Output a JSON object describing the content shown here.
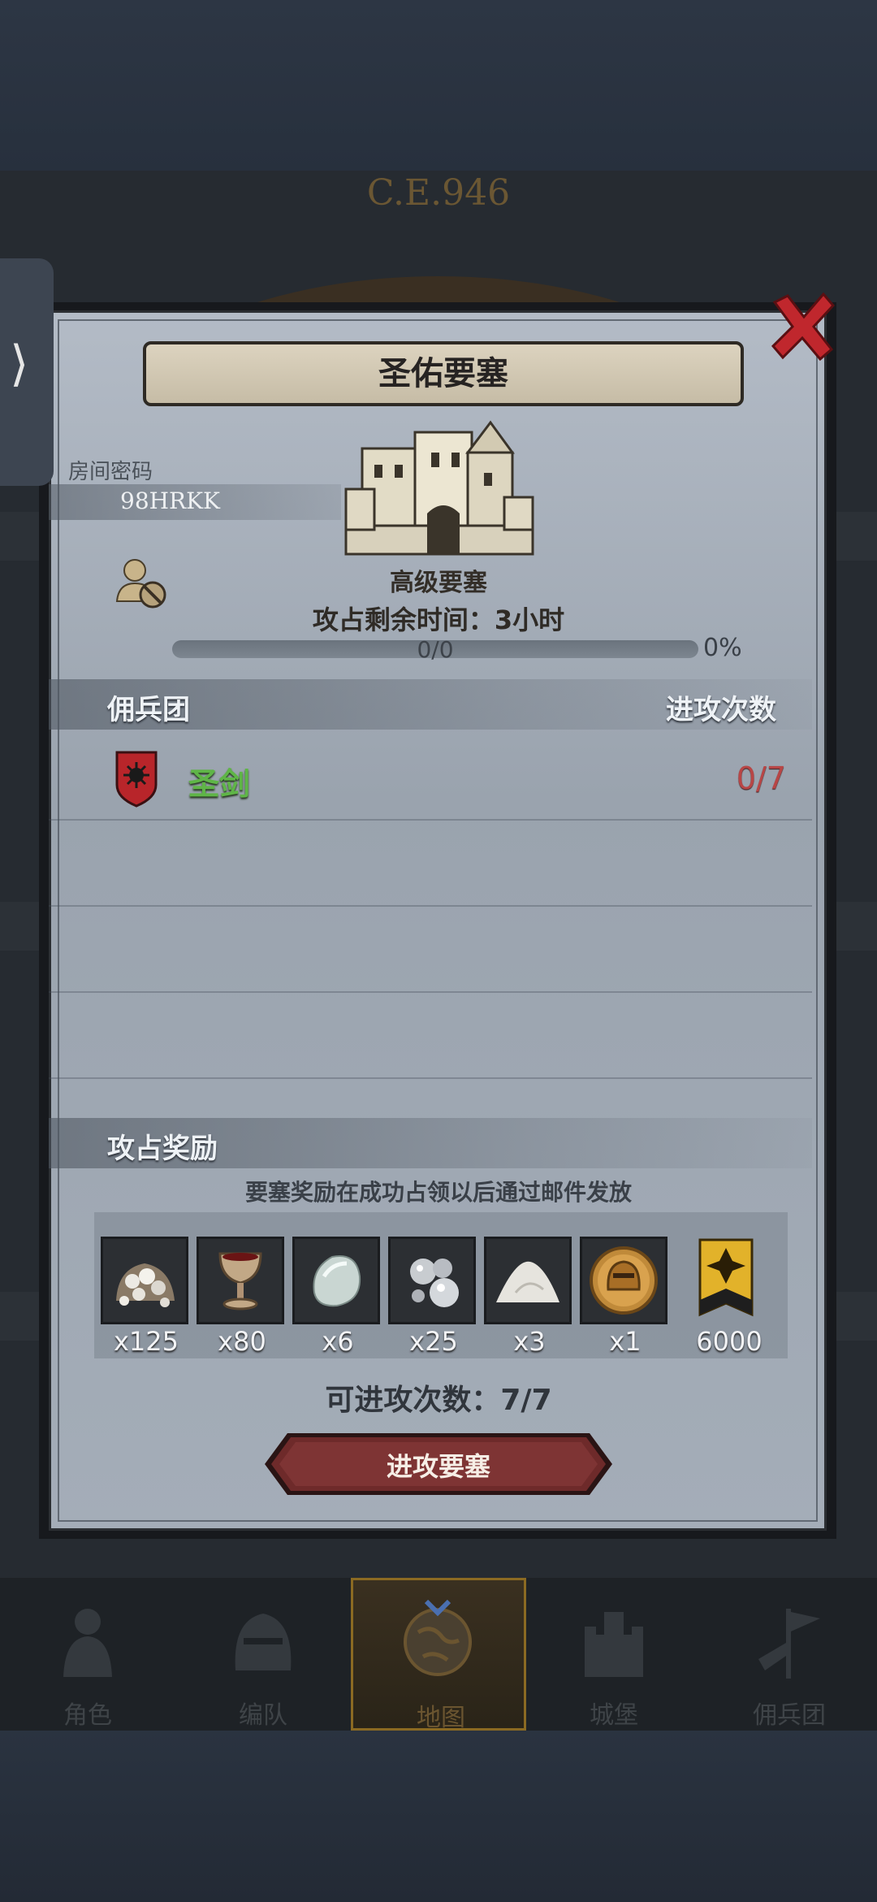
{
  "header": {
    "year": "C.E.946"
  },
  "modal": {
    "title": "圣佑要塞",
    "room_label": "房间密码",
    "room_code": "98HRKK",
    "fortress_type": "高级要塞",
    "time_label": "攻占剩余时间：",
    "time_value": "3小时",
    "progress_text": "0/0",
    "progress_pct": "0%",
    "progress_fraction": 0,
    "mercenary_header": "佣兵团",
    "attack_count_header": "进攻次数",
    "mercenaries": [
      {
        "name": "圣剑",
        "count": "0/7"
      }
    ],
    "reward_header": "攻占奖励",
    "reward_note": "要塞奖励在成功占领以后通过邮件发放",
    "rewards": [
      {
        "icon": "silver-ore-icon",
        "qty": "x125"
      },
      {
        "icon": "goblet-icon",
        "qty": "x80"
      },
      {
        "icon": "gem-stone-icon",
        "qty": "x6"
      },
      {
        "icon": "mercury-drops-icon",
        "qty": "x25"
      },
      {
        "icon": "salt-pile-icon",
        "qty": "x3"
      },
      {
        "icon": "golden-helmet-coin-icon",
        "qty": "x1"
      },
      {
        "icon": "honor-banner-icon",
        "qty": "6000"
      }
    ],
    "attempts_label": "可进攻次数：",
    "attempts_value": "7/7",
    "attack_button": "进攻要塞"
  },
  "nav": {
    "items": [
      {
        "label": "角色",
        "active": false
      },
      {
        "label": "编队",
        "active": false
      },
      {
        "label": "地图",
        "active": true
      },
      {
        "label": "城堡",
        "active": false
      },
      {
        "label": "佣兵团",
        "active": false
      }
    ]
  },
  "colors": {
    "accent_gold": "#c9a24a",
    "mercenary_green": "#5fb547",
    "count_red": "#b84646",
    "button_red": "#6e2a2a",
    "close_red": "#c0272d"
  }
}
